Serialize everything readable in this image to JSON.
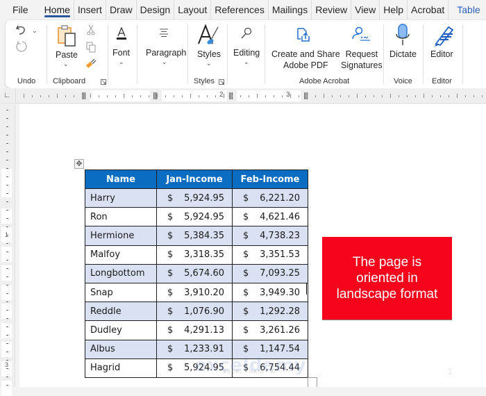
{
  "menu": {
    "tabs": [
      "File",
      "Home",
      "Insert",
      "Draw",
      "Design",
      "Layout",
      "References",
      "Mailings",
      "Review",
      "View",
      "Help",
      "Acrobat"
    ],
    "active_tab": "Home",
    "context_tab": "Table Design"
  },
  "ribbon": {
    "undo": {
      "group_label": "Undo",
      "undo_icon": "undo-icon",
      "redo_icon": "redo-icon"
    },
    "clipboard": {
      "group_label": "Clipboard",
      "paste_label": "Paste",
      "icons": [
        "paste-icon",
        "cut-icon",
        "copy-icon",
        "format-painter-icon"
      ]
    },
    "font": {
      "label": "Font"
    },
    "paragraph": {
      "label": "Paragraph"
    },
    "styles": {
      "label": "Styles",
      "group_label": "Styles"
    },
    "editing": {
      "label": "Editing"
    },
    "acrobat": {
      "create_pdf_line1": "Create and Share",
      "create_pdf_line2": "Adobe PDF",
      "request_line1": "Request",
      "request_line2": "Signatures",
      "group_label": "Adobe Acrobat"
    },
    "voice": {
      "label": "Dictate",
      "group_label": "Voice"
    },
    "editor": {
      "label": "Editor",
      "group_label": "Editor"
    }
  },
  "ruler": {
    "numbers": [
      "2",
      "3"
    ],
    "vertical_numbers": [
      "1",
      "3"
    ]
  },
  "table": {
    "headers": [
      "Name",
      "Jan-Income",
      "Feb-Income"
    ],
    "currency_symbol": "$",
    "rows": [
      {
        "name": "Harry",
        "jan": "5,924.95",
        "feb": "6,221.20"
      },
      {
        "name": "Ron",
        "jan": "5,924.95",
        "feb": "4,621.46"
      },
      {
        "name": "Hermione",
        "jan": "5,384.35",
        "feb": "4,738.23"
      },
      {
        "name": "Malfoy",
        "jan": "3,318.35",
        "feb": "3,351.53"
      },
      {
        "name": "Longbottom",
        "jan": "5,674.60",
        "feb": "7,093.25"
      },
      {
        "name": "Snap",
        "jan": "3,910.20",
        "feb": "3,949.30"
      },
      {
        "name": "Reddle",
        "jan": "1,076.90",
        "feb": "1,292.28"
      },
      {
        "name": "Dudley",
        "jan": "4,291.13",
        "feb": "3,261.26"
      },
      {
        "name": "Albus",
        "jan": "1,233.91",
        "feb": "1,147.54"
      },
      {
        "name": "Hagrid",
        "jan": "5,924.95",
        "feb": "6,754.44"
      }
    ]
  },
  "callout": {
    "text": "The page is oriented in landscape format",
    "color": "#f5041c"
  },
  "watermark": {
    "brand": "exceldemy",
    "tagline": "EXCEL · DATA · BI"
  },
  "colors": {
    "header_bg": "#0a6dc2",
    "band_bg": "#d9e1f2",
    "accent": "#2b579a",
    "context_tab": "#2b5fbd"
  }
}
